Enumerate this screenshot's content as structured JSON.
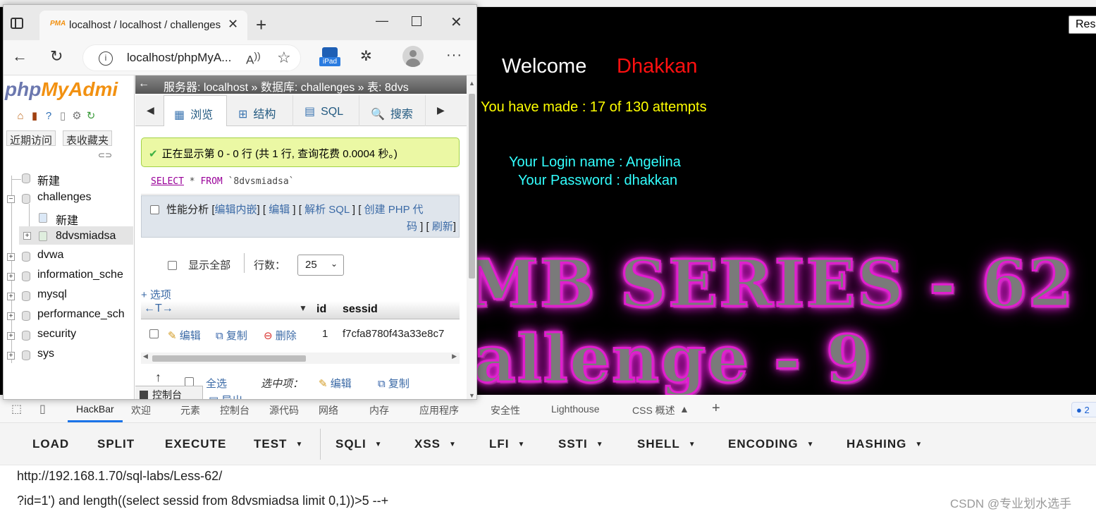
{
  "challenge_page": {
    "reset_label": "Res",
    "welcome": "Welcome",
    "username": "Dhakkan",
    "attempts": "You have made : 17 of 130 attempts",
    "login_name": "Your Login name : Angelina",
    "password": "Your Password : dhakkan",
    "series_title": "MB SERIES - 62",
    "challenge_title": "allenge - 9"
  },
  "browser": {
    "tab_title": "localhost / localhost / challenges",
    "favicon_text": "PMA",
    "address": "localhost/phpMyA...",
    "read_aloud": "A̩"
  },
  "pma": {
    "logo_main": "php",
    "logo_my": "MyAdmi",
    "recent_label": "近期访问",
    "favorites_label": "表收藏夹",
    "tree": {
      "new_root": "新建",
      "challenges": "challenges",
      "new_table": "新建",
      "table": "8dvsmiadsa",
      "dbs": [
        "dvwa",
        "information_sche",
        "mysql",
        "performance_sch",
        "security",
        "sys"
      ]
    },
    "breadcrumb": "服务器: localhost » 数据库: challenges » 表: 8dvs",
    "tabs": [
      {
        "label": "浏览",
        "icon": "▦"
      },
      {
        "label": "结构",
        "icon": "⊞"
      },
      {
        "label": "SQL",
        "icon": "▤"
      },
      {
        "label": "搜索",
        "icon": "🔍"
      }
    ],
    "success_message": "正在显示第 0 - 0 行 (共 1 行, 查询花费 0.0004 秒。)",
    "sql_keyword_select": "SELECT",
    "sql_mid": " * ",
    "sql_keyword_from": "FROM",
    "sql_table": " `8dvsmiadsa`",
    "profiling": "性能分析",
    "links": {
      "edit_inline": "编辑内嵌",
      "edit": "编辑",
      "explain": "解析 SQL",
      "create_php": "创建 PHP 代",
      "code": "码",
      "refresh": "刷新"
    },
    "show_all": "显示全部",
    "rows_label": "行数：",
    "rows_value": "25",
    "options": "+ 选项",
    "columns": {
      "id": "id",
      "sessid": "sessid"
    },
    "row": {
      "edit": "编辑",
      "copy": "复制",
      "delete": "删除",
      "id": "1",
      "sessid": "f7cfa8780f43a33e8c7"
    },
    "select_all": "全选",
    "selected_items": "选中项：",
    "bottom_edit": "编辑",
    "bottom_copy": "复制",
    "console": "控制台",
    "export": "导出"
  },
  "devtools": {
    "tabs": [
      "HackBar",
      "欢迎",
      "元素",
      "控制台",
      "源代码",
      "网络",
      "内存",
      "应用程序",
      "安全性",
      "Lighthouse",
      "CSS 概述"
    ],
    "badge": "2"
  },
  "hackbar": {
    "buttons": [
      "LOAD",
      "SPLIT",
      "EXECUTE",
      "TEST",
      "SQLI",
      "XSS",
      "LFI",
      "SSTI",
      "SHELL",
      "ENCODING",
      "HASHING"
    ],
    "url_line1": "http://192.168.1.70/sql-labs/Less-62/",
    "url_line2": "?id=1') and length((select sessid from 8dvsmiadsa limit 0,1))>5 --+",
    "watermark": "CSDN @专业划水选手"
  },
  "colors": {
    "username": "#ff1010",
    "attempts": "#ffff00",
    "credentials": "#33ffff",
    "neon": "#e11ecf",
    "hackbar_accent": "#1a73e8",
    "pma_link": "#3b6aa6"
  }
}
